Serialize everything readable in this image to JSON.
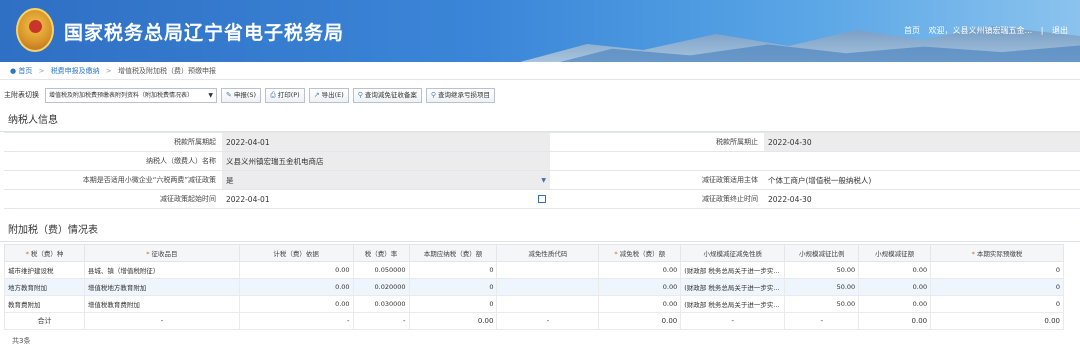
{
  "header": {
    "title": "国家税务总局辽宁省电子税务局",
    "home": "首页",
    "welcome": "欢迎，义县义州镇宏瑞五金...",
    "sep": "|",
    "logout": "退出",
    "emblem_text": "中国税务"
  },
  "breadcrumb": {
    "home": "首页",
    "level1": "税费申报及缴纳",
    "level2": "增值税及附加税（费）预缴申报",
    "sep": ">"
  },
  "toolbar": {
    "label": "主附表切换",
    "select_value": "增值税及附加税费预缴表附列资料（附加税费情况表）",
    "buttons": [
      "申报(S)",
      "打印(P)",
      "导出(E)",
      "查询減免征收备案",
      "查询继承亏损项目"
    ]
  },
  "taxpayer": {
    "section_title": "纳税人信息",
    "rows": [
      {
        "l1": "税款所属期起",
        "v1": "2022-04-01",
        "l2": "税款所属期止",
        "v2": "2022-04-30"
      },
      {
        "l1": "纳税人（缴费人）名称",
        "v1": "义县义州镇宏瑞五金机电商店",
        "l2": "",
        "v2": ""
      },
      {
        "l1": "本期是否适用小微企业“六税两费”减征政策",
        "v1": "是",
        "l2": "减征政策适用主体",
        "v2": "个体工商户(增值税一般纳税人)"
      },
      {
        "l1": "减征政策起始时间",
        "v1": "2022-04-01",
        "l2": "减征政策终止时间",
        "v2": "2022-04-30"
      }
    ]
  },
  "surtax": {
    "section_title": "附加税（费）情况表",
    "columns": [
      "税（费）种",
      "征收品目",
      "计税（费）依据",
      "税（费）率",
      "本期应纳税（费）额",
      "减免性质代码",
      "减免税（费）额",
      "小规模减征减免性质",
      "小规模减征比例",
      "小规模减征额",
      "本期实际预缴税"
    ],
    "rows": [
      [
        "城市维护建设税",
        "县城、镇（增值税附征）",
        "0.00",
        "0.050000",
        "0",
        "",
        "0.00",
        "(财政部 税务总局关于进一步实...",
        "50.00",
        "0.00",
        "0"
      ],
      [
        "地方教育附加",
        "增值税地方教育附加",
        "0.00",
        "0.020000",
        "0",
        "",
        "0.00",
        "(财政部 税务总局关于进一步实...",
        "50.00",
        "0.00",
        "0"
      ],
      [
        "教育费附加",
        "增值税教育费附加",
        "0.00",
        "0.030000",
        "0",
        "",
        "0.00",
        "(财政部 税务总局关于进一步实...",
        "50.00",
        "0.00",
        "0"
      ]
    ],
    "total": [
      "合计",
      "-",
      "-",
      "-",
      "0.00",
      "-",
      "0.00",
      "-",
      "-",
      "0.00",
      "0.00"
    ],
    "count": "共3条"
  }
}
